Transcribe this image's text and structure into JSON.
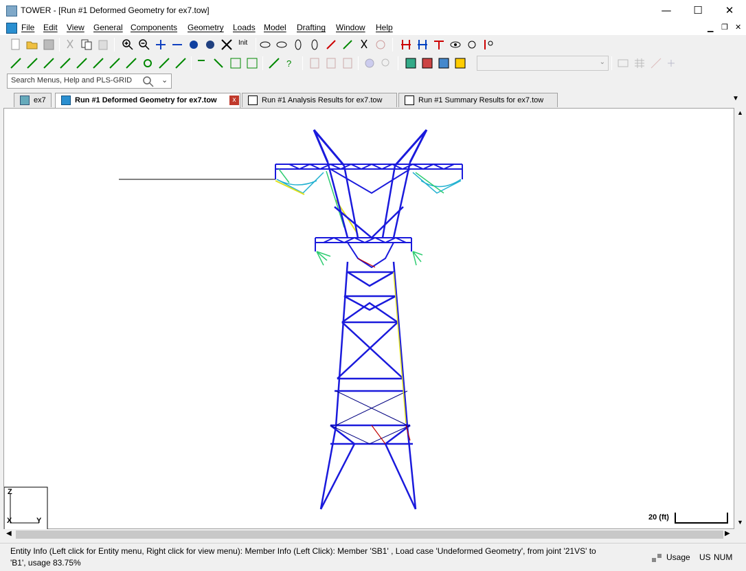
{
  "app": {
    "name": "TOWER",
    "title": "[Run #1 Deformed Geometry for ex7.tow]"
  },
  "menu": [
    "File",
    "Edit",
    "View",
    "General",
    "Components",
    "Geometry",
    "Loads",
    "Model",
    "Drafting",
    "Window",
    "Help"
  ],
  "toolbar": {
    "init_label": "Init"
  },
  "search": {
    "placeholder": "Search Menus, Help and PLS-GRID"
  },
  "tabs": [
    {
      "label": "ex7"
    },
    {
      "label": "Run #1 Deformed Geometry for ex7.tow"
    },
    {
      "label": "Run #1 Analysis Results for ex7.tow"
    },
    {
      "label": "Run #1 Summary Results for ex7.tow"
    }
  ],
  "view": {
    "scale_label": "20 (ft)",
    "axis_z": "Z",
    "axis_x": "X",
    "axis_y": "Y"
  },
  "status": {
    "line1": "Entity Info (Left click for Entity menu, Right click for view menu): Member Info (Left Click): Member 'SB1' , Load case 'Undeformed Geometry', from joint '21VS' to",
    "line2": "'B1', usage 83.75%",
    "usage_label": "Usage",
    "units": "US",
    "num": "NUM"
  },
  "colors": {
    "member_blue": "#1a1adc",
    "member_dark": "#000080",
    "member_green": "#2ecc71",
    "member_yellow": "#e0e020",
    "member_cyan": "#20b0d0",
    "member_red": "#c00000"
  }
}
